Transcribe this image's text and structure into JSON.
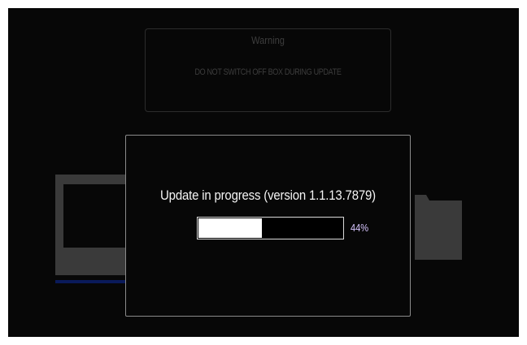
{
  "warning": {
    "title": "Warning",
    "message": "DO NOT SWITCH OFF BOX DURING UPDATE"
  },
  "background_icons": [
    "monitor-icon",
    "folder-icon"
  ],
  "progress": {
    "message": "Update in progress (version 1.1.13.7879)",
    "percent_label": "44%",
    "fraction": 0.44
  },
  "colors": {
    "background": "#070707",
    "dialog_border": "#8a8a8a",
    "bar_fill": "#ffffff",
    "percent_text": "#d8c6ff",
    "dimmed_icon": "#3a3a3a"
  }
}
